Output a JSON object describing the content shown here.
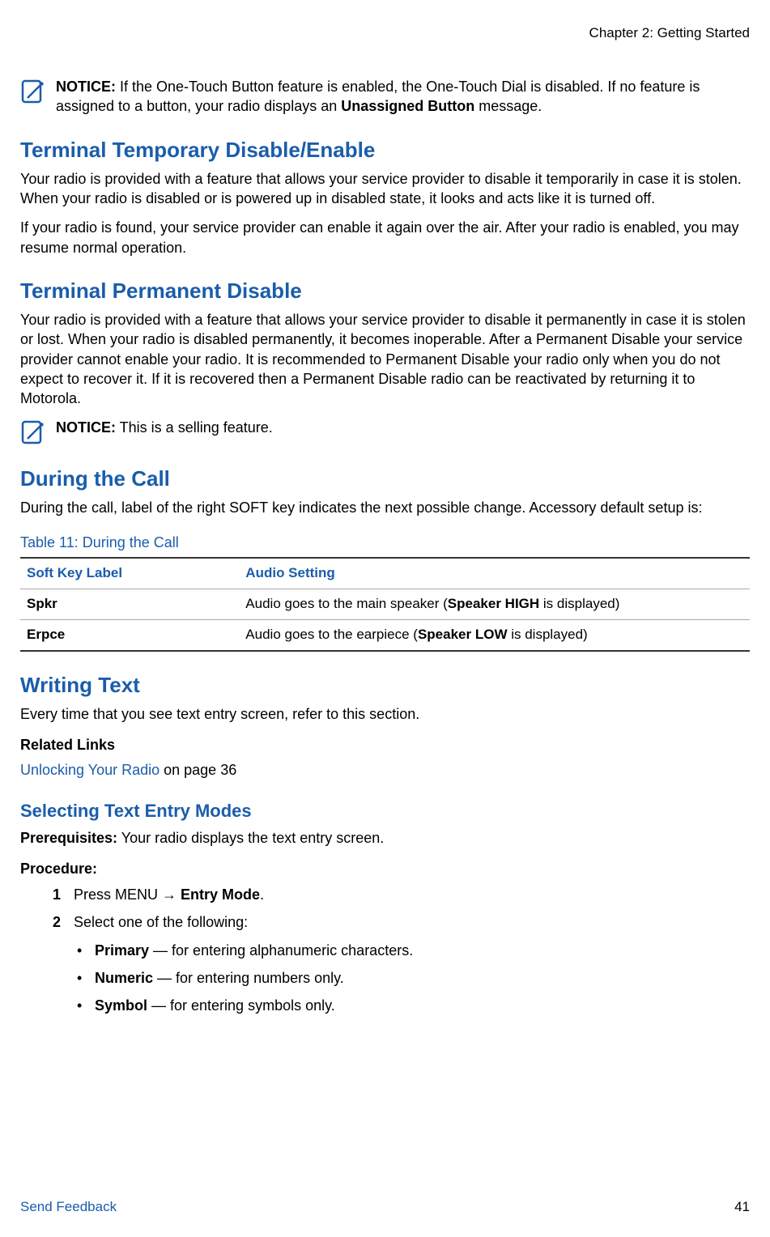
{
  "header": {
    "chapter": "Chapter 2: Getting Started"
  },
  "notice1": {
    "label": "NOTICE:",
    "text_part1": " If the One-Touch Button feature is enabled, the One-Touch Dial is disabled. If no feature is assigned to a button, your radio displays an ",
    "bold1": "Unassigned Button",
    "text_part2": " message."
  },
  "section_ttde": {
    "heading": "Terminal Temporary Disable/Enable",
    "p1": "Your radio is provided with a feature that allows your service provider to disable it temporarily in case it is stolen. When your radio is disabled or is powered up in disabled state, it looks and acts like it is turned off.",
    "p2": "If your radio is found, your service provider can enable it again over the air. After your radio is enabled, you may resume normal operation."
  },
  "section_tpd": {
    "heading": "Terminal Permanent Disable",
    "p1": "Your radio is provided with a feature that allows your service provider to disable it permanently in case it is stolen or lost. When your radio is disabled permanently, it becomes inoperable. After a Permanent Disable your service provider cannot enable your radio. It is recommended to Permanent Disable your radio only when you do not expect to recover it. If it is recovered then a Permanent Disable radio can be reactivated by returning it to Motorola."
  },
  "notice2": {
    "label": "NOTICE:",
    "text": " This is a selling feature."
  },
  "section_during_call": {
    "heading": "During the Call",
    "intro_part1": "During the call, label of the right S",
    "intro_smallcaps": "OFT",
    "intro_part2": " key indicates the next possible change. Accessory default setup is:"
  },
  "table11": {
    "caption": "Table 11: During the Call",
    "headers": {
      "col1": "Soft Key Label",
      "col2": "Audio Setting"
    },
    "rows": [
      {
        "c1": "Spkr",
        "c2_pre": "Audio goes to the main speaker (",
        "c2_bold": "Speaker HIGH",
        "c2_post": " is displayed)"
      },
      {
        "c1": "Erpce",
        "c2_pre": "Audio goes to the earpiece (",
        "c2_bold": "Speaker LOW",
        "c2_post": " is displayed)"
      }
    ]
  },
  "section_writing": {
    "heading": "Writing Text",
    "p1": "Every time that you see text entry screen, refer to this section.",
    "related_links_label": "Related Links",
    "link_text": "Unlocking Your Radio",
    "link_suffix": " on page 36"
  },
  "section_selecting": {
    "heading": "Selecting Text Entry Modes",
    "prereq_label": "Prerequisites:",
    "prereq_text": " Your radio displays the text entry screen.",
    "procedure_label": "Procedure:",
    "step1_pre": "Press M",
    "step1_sc": "ENU",
    "step1_arrow": " → ",
    "step1_bold": "Entry Mode",
    "step1_post": ".",
    "step2": "Select one of the following:",
    "bullets": [
      {
        "bold": "Primary",
        "rest": " — for entering alphanumeric characters."
      },
      {
        "bold": "Numeric",
        "rest": " — for entering numbers only."
      },
      {
        "bold": "Symbol",
        "rest": " — for entering symbols only."
      }
    ]
  },
  "footer": {
    "left": "Send Feedback",
    "right": "41"
  }
}
